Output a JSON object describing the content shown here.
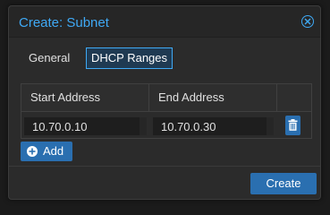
{
  "dialog": {
    "title": "Create: Subnet",
    "accent_color": "#3fa9f5",
    "button_color": "#2a6fb0"
  },
  "tabs": [
    {
      "label": "General",
      "active": false
    },
    {
      "label": "DHCP Ranges",
      "active": true
    }
  ],
  "grid": {
    "columns": [
      "Start Address",
      "End Address",
      ""
    ],
    "rows": [
      {
        "start": "10.70.0.10",
        "end": "10.70.0.30"
      }
    ]
  },
  "actions": {
    "add_label": "Add",
    "create_label": "Create"
  },
  "icons": {
    "close": "close-circle-icon",
    "delete": "trash-icon",
    "add": "plus-circle-icon"
  }
}
